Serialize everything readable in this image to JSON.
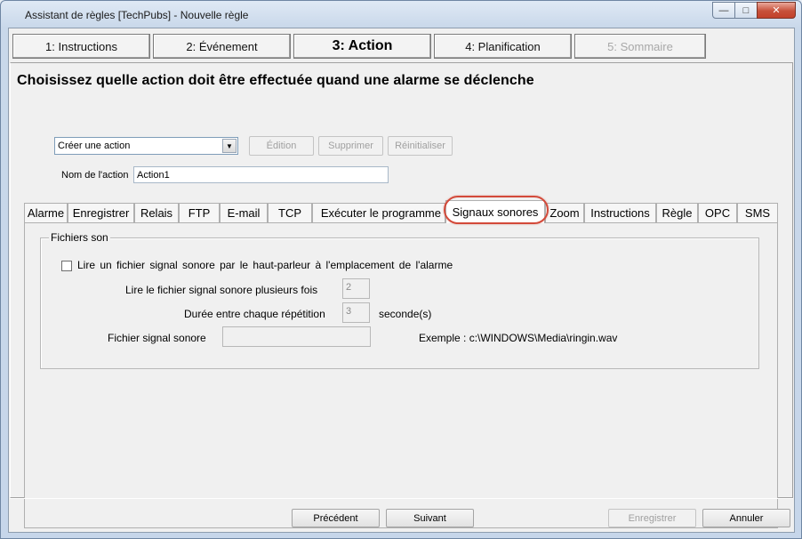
{
  "window": {
    "title": "Assistant de règles [TechPubs] - Nouvelle règle",
    "minimize_glyph": "—",
    "maximize_glyph": "□",
    "close_glyph": "✕"
  },
  "steps": [
    {
      "label": "1: Instructions",
      "state": "normal"
    },
    {
      "label": "2: Événement",
      "state": "normal"
    },
    {
      "label": "3: Action",
      "state": "active"
    },
    {
      "label": "4: Planification",
      "state": "normal"
    },
    {
      "label": "5: Sommaire",
      "state": "disabled"
    }
  ],
  "heading": "Choisissez quelle action doit être effectuée quand une alarme se déclenche",
  "action_select": {
    "value": "Créer une action"
  },
  "action_buttons": {
    "edit": "Édition",
    "delete": "Supprimer",
    "reset": "Réinitialiser"
  },
  "action_name": {
    "label": "Nom de l'action",
    "value": "Action1"
  },
  "tabs": [
    "Alarme",
    "Enregistrer",
    "Relais",
    "FTP",
    "E-mail",
    "TCP",
    "Exécuter le programme",
    "Signaux sonores",
    "Zoom",
    "Instructions",
    "Règle",
    "OPC",
    "SMS"
  ],
  "selected_tab": "Signaux sonores",
  "sound_files": {
    "group_title": "Fichiers son",
    "play_checkbox_label": "Lire un fichier signal sonore par le haut-parleur à l'emplacement de l'alarme",
    "play_checked": false,
    "repeat_label": "Lire le fichier signal sonore plusieurs fois",
    "repeat_value": "2",
    "interval_label": "Durée entre chaque répétition",
    "interval_value": "3",
    "interval_unit": "seconde(s)",
    "file_label": "Fichier signal sonore",
    "file_value": "",
    "example_text": "Exemple : c:\\WINDOWS\\Media\\ringin.wav"
  },
  "footer": {
    "previous": "Précédent",
    "next": "Suivant",
    "save": "Enregistrer",
    "cancel": "Annuler"
  },
  "colors": {
    "highlight_ring": "#d34a3a",
    "close_button": "#c7503a"
  }
}
